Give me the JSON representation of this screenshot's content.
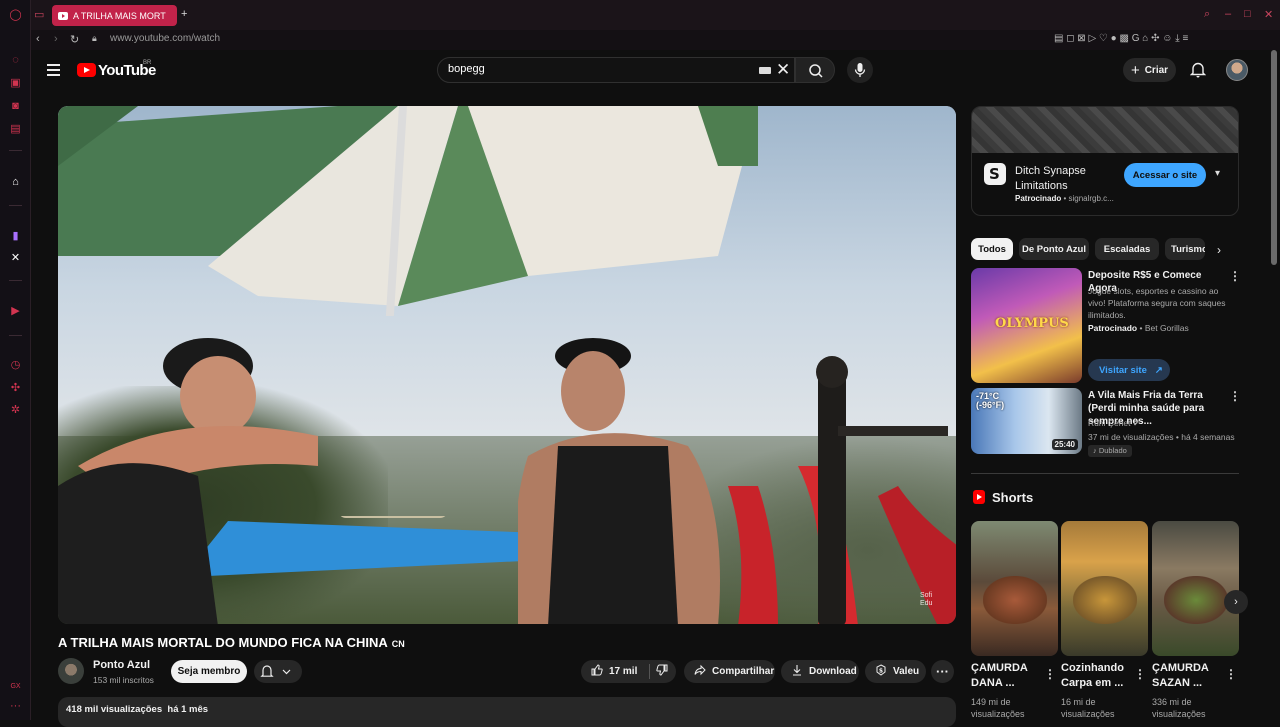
{
  "browser": {
    "tab_title": "A TRILHA MAIS MORT",
    "url": "www.youtube.com/watch"
  },
  "yt": {
    "logo_text": "YouTube",
    "country_code": "BR",
    "search_query": "bopegg",
    "create_label": "Criar"
  },
  "video": {
    "title": "A TRILHA MAIS MORTAL DO MUNDO FICA NA CHINA",
    "title_flag": "CN",
    "watermark_line1": "Sofi",
    "watermark_line2": "Edu",
    "channel_name": "Ponto Azul",
    "channel_subs": "153 mil inscritos",
    "member_label": "Seja membro",
    "likes": "17 mil",
    "share_label": "Compartilhar",
    "download_label": "Download",
    "thanks_label": "Valeu",
    "more_label": "···",
    "views": "418 mil visualizações",
    "age": "há 1 mês"
  },
  "ad": {
    "title": "Ditch Synapse Limitations",
    "sponsored": "Patrocinado",
    "domain": "signalrgb.c...",
    "cta": "Acessar o site"
  },
  "chips": [
    "Todos",
    "De Ponto Azul",
    "Escaladas",
    "Turismo"
  ],
  "recs": [
    {
      "title": "Deposite R$5 e Comece Agora",
      "desc": "Jogue slots, esportes e cassino ao vivo! Plataforma segura com saques ilimitados.",
      "sponsored": "Patrocinado",
      "advertiser": "Bet Gorillas",
      "thumb_text": "OLYMPUS",
      "cta": "Visitar site"
    },
    {
      "title": "A Vila Mais Fria da Terra (Perdi minha saúde para sempre nes...",
      "channel": "Ruhi Çenet",
      "meta": "37 mi de visualizações • há 4 semanas",
      "duration": "25:40",
      "thumb_text_1": "-71°C",
      "thumb_text_2": "(-96°F)",
      "badge": "Dublado"
    }
  ],
  "shorts": {
    "heading": "Shorts",
    "items": [
      {
        "title": "ÇAMURDA DANA ...",
        "views": "149 mi de visualizações"
      },
      {
        "title": "Cozinhando Carpa em ...",
        "views": "16 mi de visualizações"
      },
      {
        "title": "ÇAMURDA SAZAN ...",
        "views": "336 mi de visualizações"
      }
    ]
  },
  "colors": {
    "opera_accent": "#c2234a",
    "yt_red": "#ff0000",
    "link_blue": "#3ea6ff",
    "background": "#0f0f0f"
  }
}
